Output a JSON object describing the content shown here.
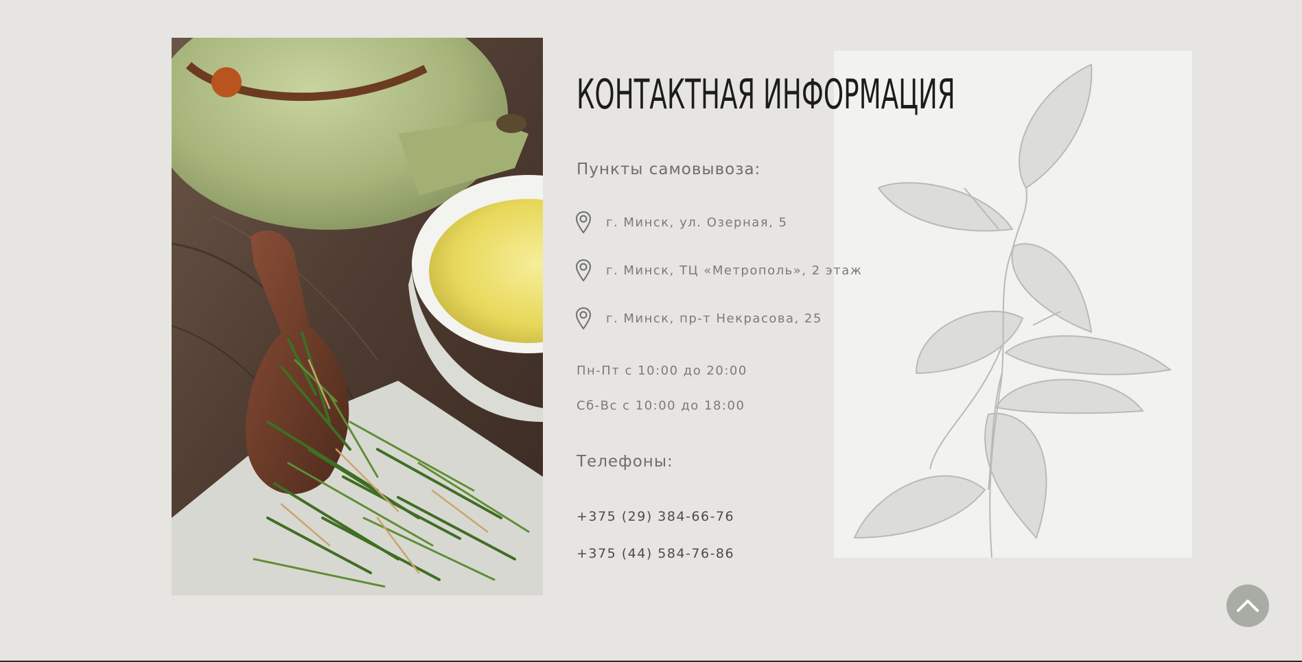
{
  "contacts": {
    "title": "КОНТАКТНАЯ ИНФОРМАЦИЯ",
    "pickup_heading": "Пункты самовывоза:",
    "addresses": [
      "г. Минск, ул. Озерная, 5",
      "г. Минск, ТЦ «Метрополь», 2 этаж",
      "г. Минск, пр-т Некрасова, 25"
    ],
    "hours": [
      "Пн-Пт с 10:00 до 20:00",
      "Сб-Вс с 10:00 до 18:00"
    ],
    "phones_heading": "Телефоны:",
    "phones": [
      "+375 (29) 384-66-76",
      "+375 (44) 584-76-86"
    ]
  },
  "icons": {
    "address": "location-pin-icon",
    "scroll_top": "chevron-up-icon"
  },
  "colors": {
    "background": "#e6e5e1",
    "panel": "#f2f2f0",
    "title": "#1c1c1a",
    "text": "#7a7a76",
    "scroll_button": "#a9aca5"
  }
}
